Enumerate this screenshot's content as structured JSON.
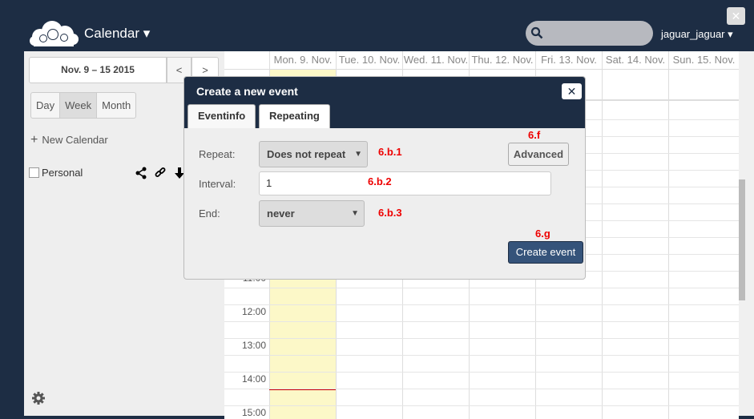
{
  "header": {
    "app_title": "Calendar ▾",
    "search_placeholder": "",
    "user": "jaguar_jaguar ▾",
    "close_label": "✕"
  },
  "sidebar": {
    "date_range": "Nov. 9 – 15 2015",
    "prev_label": "<",
    "next_label": ">",
    "views": [
      "Day",
      "Week",
      "Month"
    ],
    "active_view": "Week",
    "new_calendar_label": "New Calendar",
    "calendars": [
      {
        "name": "Personal",
        "checked": false
      }
    ]
  },
  "calendar": {
    "days": [
      "Mon. 9. Nov.",
      "Tue. 10. Nov.",
      "Wed. 11. Nov.",
      "Thu. 12. Nov.",
      "Fri. 13. Nov.",
      "Sat. 14. Nov.",
      "Sun. 15. Nov."
    ],
    "times": [
      "11:00",
      "12:00",
      "13:00",
      "14:00",
      "15:00"
    ],
    "today_highlight_color": "#fcf8c8",
    "accent_color": "#1d2d44"
  },
  "dialog": {
    "title": "Create a new event",
    "close_label": "✕",
    "tabs": [
      "Eventinfo",
      "Repeating"
    ],
    "active_tab": "Repeating",
    "repeat_label": "Repeat:",
    "repeat_value": "Does not repeat",
    "interval_label": "Interval:",
    "interval_value": "1",
    "end_label": "End:",
    "end_value": "never",
    "advanced_label": "Advanced",
    "create_label": "Create event"
  },
  "annotations": {
    "a_6f": "6.f",
    "a_6b1": "6.b.1",
    "a_6b2": "6.b.2",
    "a_6b3": "6.b.3",
    "a_6g": "6.g"
  }
}
